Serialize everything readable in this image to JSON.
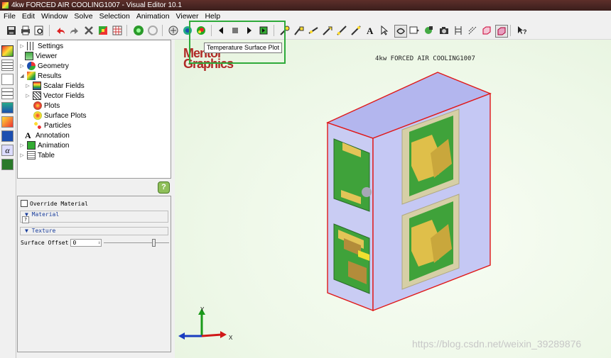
{
  "window": {
    "title": "4kw FORCED AIR COOLING1007 - Visual Editor 10.1"
  },
  "menu": [
    "File",
    "Edit",
    "Window",
    "Solve",
    "Selection",
    "Animation",
    "Viewer",
    "Help"
  ],
  "toolbar": {
    "tooltip": "Temperature Surface Plot",
    "icons": [
      "save-icon",
      "print-icon",
      "print-preview-icon",
      "undo-icon",
      "redo-icon",
      "delete-icon",
      "color-map-icon",
      "grid-icon",
      "solve-icon",
      "refresh-icon",
      "vector-plot-icon",
      "scalar-plot-icon",
      "temperature-surface-plot-icon",
      "step-back-icon",
      "stop-icon",
      "play-icon",
      "step-end-icon",
      "probe-icon",
      "annotate-icon",
      "text-icon",
      "select-arrow-icon",
      "rotate-view-icon",
      "camera-icon",
      "clip-icon",
      "box-icon",
      "help-pointer-icon"
    ]
  },
  "tree": {
    "items": [
      {
        "label": "Settings",
        "icon": "settings-icon"
      },
      {
        "label": "Viewer",
        "icon": "viewer-icon"
      },
      {
        "label": "Geometry",
        "icon": "geometry-icon"
      },
      {
        "label": "Results",
        "icon": "results-icon"
      },
      {
        "label": "Scalar Fields",
        "icon": "scalar-fields-icon"
      },
      {
        "label": "Vector Fields",
        "icon": "vector-fields-icon"
      },
      {
        "label": "Plots",
        "icon": "plots-icon"
      },
      {
        "label": "Surface Plots",
        "icon": "surface-plots-icon"
      },
      {
        "label": "Particles",
        "icon": "particles-icon"
      },
      {
        "label": "Annotation",
        "icon": "annotation-icon"
      },
      {
        "label": "Animation",
        "icon": "animation-icon"
      },
      {
        "label": "Table",
        "icon": "table-icon"
      }
    ]
  },
  "properties": {
    "override_material": "Override Material",
    "material_section": "Material",
    "material_value": "?",
    "texture_section": "Texture",
    "surface_offset_label": "Surface Offset",
    "surface_offset_value": "0",
    "slider_fraction": 0.78
  },
  "viewport": {
    "title": "4kw FORCED AIR COOLING1007",
    "logo_line1": "Mentor",
    "logo_line2": "Graphics",
    "axis_y": "Y",
    "axis_x": "X",
    "watermark": "https://blog.csdn.net/weixin_39289876"
  },
  "colors": {
    "box_face": "#c5c8f4",
    "box_edge": "#e01818",
    "pcb_green": "#3fa23a",
    "component_gold": "#d8b43c",
    "highlight": "#2eaa3a"
  }
}
